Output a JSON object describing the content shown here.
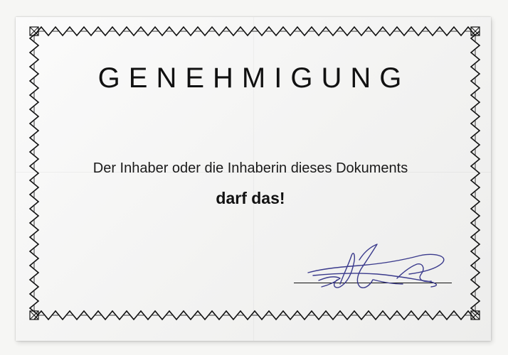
{
  "document": {
    "title": "GENEHMIGUNG",
    "body_line": "Der Inhaber oder die Inhaberin dieses Dokuments",
    "emphasis_line": "darf das!"
  },
  "colors": {
    "ink": "#111111",
    "signature_ink": "#3a3a8c",
    "paper": "#f8f8f7"
  },
  "icons": {
    "border": "zigzag-certificate-border-icon",
    "signature": "handwritten-signature-icon"
  }
}
